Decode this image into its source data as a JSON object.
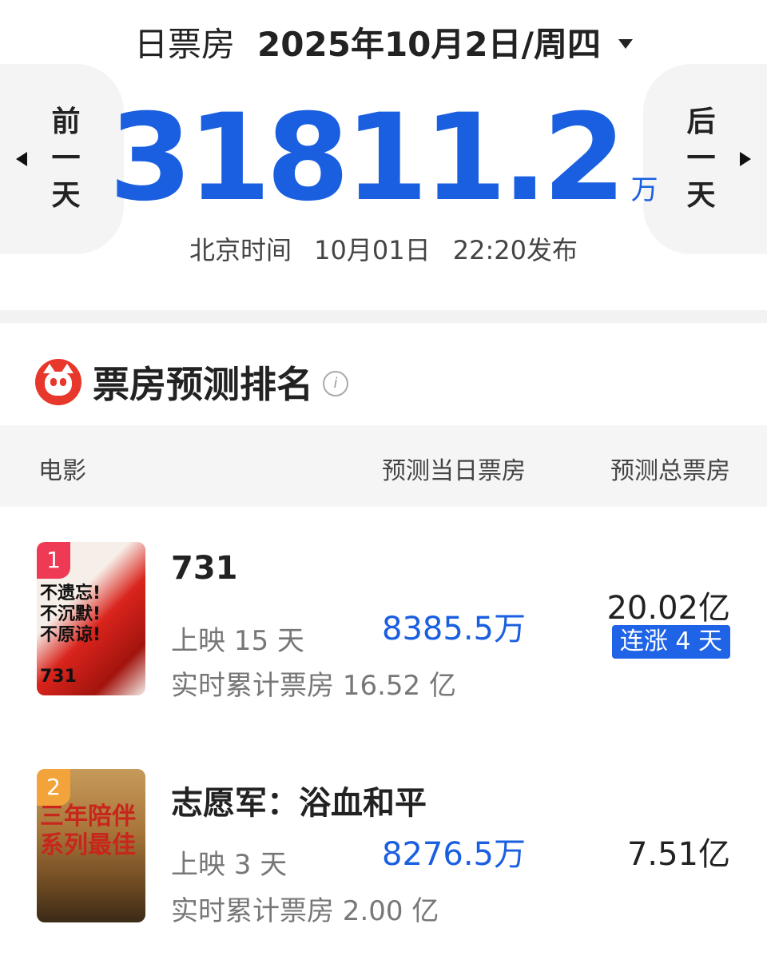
{
  "header": {
    "label": "日票房",
    "date": "2025年10月2日/周四",
    "prev_label": [
      "前",
      "一",
      "天"
    ],
    "next_label": [
      "后",
      "一",
      "天"
    ]
  },
  "summary": {
    "total": "31811.2",
    "unit": "万",
    "release_info": "北京时间 10月01日 22:20发布"
  },
  "ranking": {
    "title": "票房预测排名",
    "columns": [
      "电影",
      "预测当日票房",
      "预测总票房"
    ],
    "movies": [
      {
        "rank": "1",
        "title": "731",
        "days": "上映 15 天",
        "cumulative": "实时累计票房 16.52 亿",
        "today": "8385.5万",
        "total": "20.02亿",
        "streak": "连涨 4 天",
        "poster_text": "不遗忘!\n不沉默!\n不原谅!\n731"
      },
      {
        "rank": "2",
        "title": "志愿军：浴血和平",
        "days": "上映 3 天",
        "cumulative": "实时累计票房 2.00 亿",
        "today": "8276.5万",
        "total": "7.51亿",
        "streak": "",
        "poster_text": "三年陪伴\n系列最佳"
      }
    ]
  },
  "colors": {
    "accent": "#1a5fe0",
    "brand_red": "#e8372b",
    "badge_1": "#ef3a55",
    "badge_2": "#f2a43a"
  },
  "icons": [
    "caret-down-icon",
    "chevron-left-icon",
    "chevron-right-icon",
    "maoyan-logo-icon",
    "info-icon"
  ]
}
